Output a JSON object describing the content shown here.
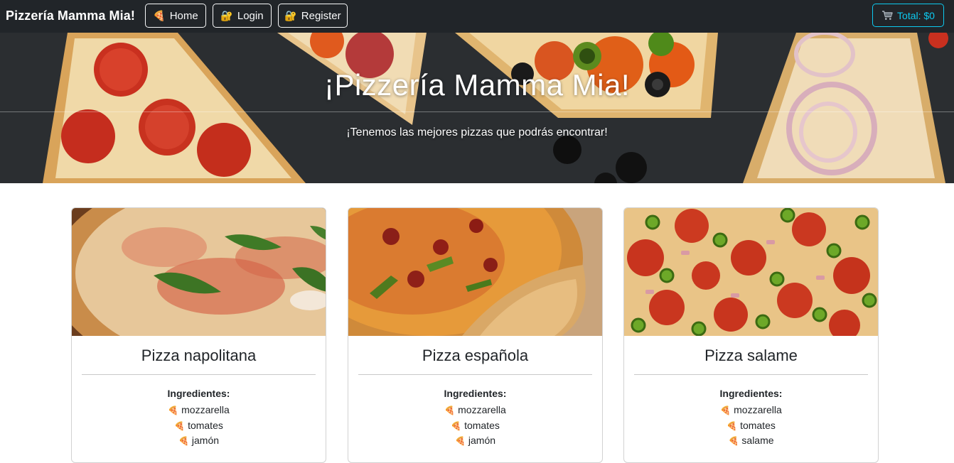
{
  "navbar": {
    "brand": "Pizzería Mamma Mia!",
    "buttons": {
      "home": {
        "label": "Home",
        "icon": "pizza-slice-icon"
      },
      "login": {
        "label": "Login",
        "icon": "lock-icon"
      },
      "register": {
        "label": "Register",
        "icon": "lock-icon"
      }
    },
    "cart": {
      "label": "Total: $0",
      "icon": "cart-icon"
    }
  },
  "hero": {
    "title": "¡Pizzería Mamma Mia!",
    "subtitle": "¡Tenemos las mejores pizzas que podrás encontrar!"
  },
  "cards": [
    {
      "name": "Pizza napolitana",
      "ingredients_heading": "Ingredientes:",
      "ingredients": [
        "mozzarella",
        "tomates",
        "jamón"
      ]
    },
    {
      "name": "Pizza española",
      "ingredients_heading": "Ingredientes:",
      "ingredients": [
        "mozzarella",
        "tomates",
        "jamón"
      ]
    },
    {
      "name": "Pizza salame",
      "ingredients_heading": "Ingredientes:",
      "ingredients": [
        "mozzarella",
        "tomates",
        "salame"
      ]
    }
  ],
  "colors": {
    "navbar_bg": "#212529",
    "cart_accent": "#0dcaf0",
    "hero_bg": "#2a2d30"
  }
}
